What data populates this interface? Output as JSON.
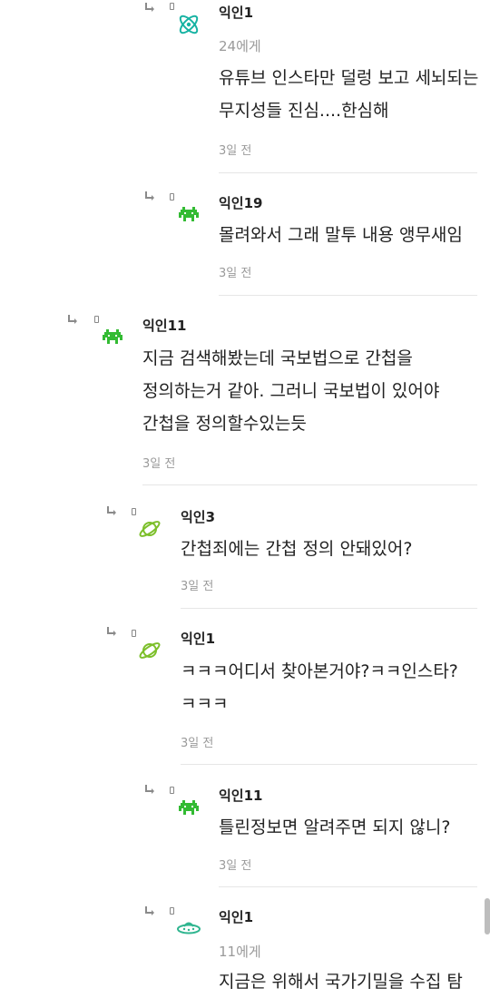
{
  "colors": {
    "text": "#222222",
    "meta": "#9a9a9a",
    "divider": "#e6e6e6",
    "icon_teal": "#17b3a3",
    "icon_green": "#33bb33",
    "icon_lime": "#7cbf2a",
    "icon_mint": "#2fb58f"
  },
  "comments": [
    {
      "author": "익인1",
      "mention": "24에게",
      "text": "유튜브 인스타만 덜렁 보고 세뇌되는 무지성들 진심....한심해",
      "time": "3일 전",
      "avatar_icon": "atom-icon"
    },
    {
      "author": "익인19",
      "text": "몰려와서 그래 말투 내용 앵무새임",
      "time": "3일 전",
      "avatar_icon": "space-invader-icon"
    },
    {
      "author": "익인11",
      "text": "지금 검색해봤는데 국보법으로 간첩을 정의하는거 같아. 그러니 국보법이 있어야 간첩을 정의할수있는듯",
      "time": "3일 전",
      "avatar_icon": "space-invader-icon"
    },
    {
      "author": "익인3",
      "text": "간첩죄에는 간첩 정의 안돼있어?",
      "time": "3일 전",
      "avatar_icon": "planet-icon"
    },
    {
      "author": "익인1",
      "text": "ㅋㅋㅋ어디서 찾아본거야?ㅋㅋ인스타?ㅋㅋㅋ",
      "time": "3일 전",
      "avatar_icon": "planet-icon"
    },
    {
      "author": "익인11",
      "text": "틀린정보면 알려주면 되지 않니?",
      "time": "3일 전",
      "avatar_icon": "space-invader-icon"
    },
    {
      "author": "익인1",
      "mention": "11에게",
      "text": "지금은 위해서 국가기밀을 수집 탐",
      "avatar_icon": "ufo-icon"
    }
  ]
}
